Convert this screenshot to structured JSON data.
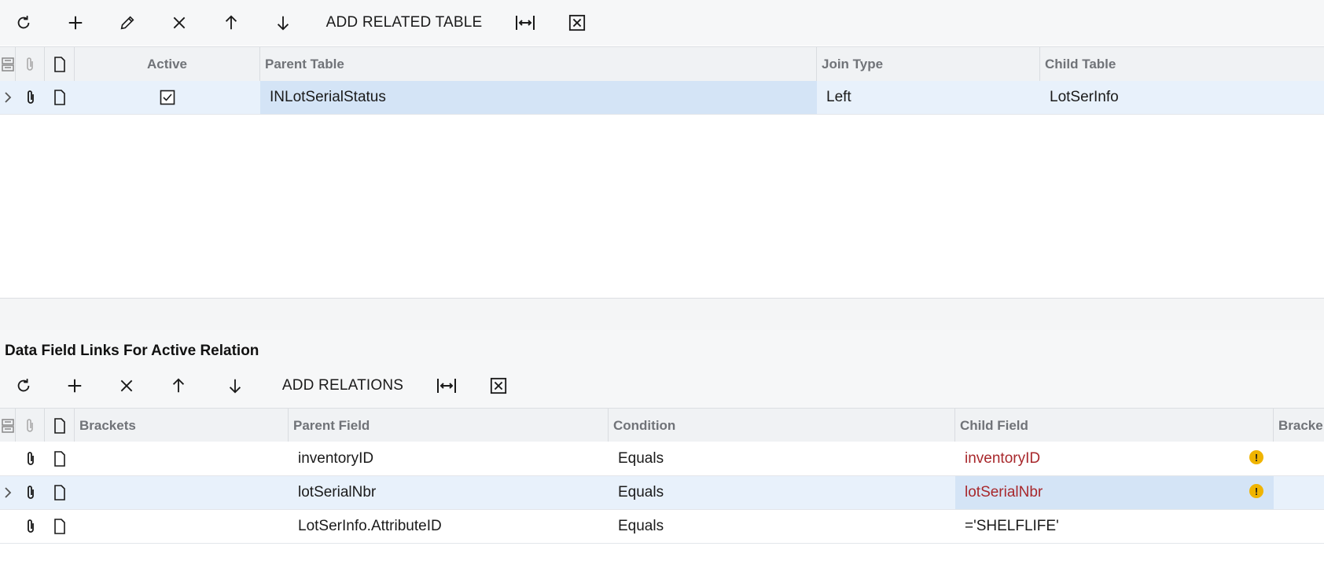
{
  "top_toolbar": {
    "add_related_table_label": "ADD RELATED TABLE",
    "icons": [
      "refresh-icon",
      "plus-icon",
      "pencil-icon",
      "close-icon",
      "arrow-up-icon",
      "arrow-down-icon",
      "fit-columns-icon",
      "excel-icon"
    ]
  },
  "relations_grid": {
    "columns": {
      "active": "Active",
      "parent_table": "Parent Table",
      "join_type": "Join Type",
      "child_table": "Child Table"
    },
    "rows": [
      {
        "active": true,
        "parent_table": "INLotSerialStatus",
        "join_type": "Left",
        "child_table": "LotSerInfo"
      }
    ]
  },
  "links_section": {
    "title": "Data Field Links For Active Relation",
    "add_relations_label": "ADD RELATIONS",
    "columns": {
      "brackets": "Brackets",
      "parent_field": "Parent Field",
      "condition": "Condition",
      "child_field": "Child Field",
      "brackets_close": "Bracke"
    },
    "rows": [
      {
        "parent_field": "inventoryID",
        "condition": "Equals",
        "child_field": "inventoryID",
        "child_error": true,
        "warning": "!"
      },
      {
        "parent_field": "lotSerialNbr",
        "condition": "Equals",
        "child_field": "lotSerialNbr",
        "child_error": true,
        "warning": "!"
      },
      {
        "parent_field": "LotSerInfo.AttributeID",
        "condition": "Equals",
        "child_field": "='SHELFLIFE'",
        "child_error": false
      }
    ]
  },
  "colors": {
    "error_text": "#a8282c",
    "selected_row": "#e8f1fb",
    "selected_cell": "#d4e4f6",
    "warning": "#f0b400"
  }
}
